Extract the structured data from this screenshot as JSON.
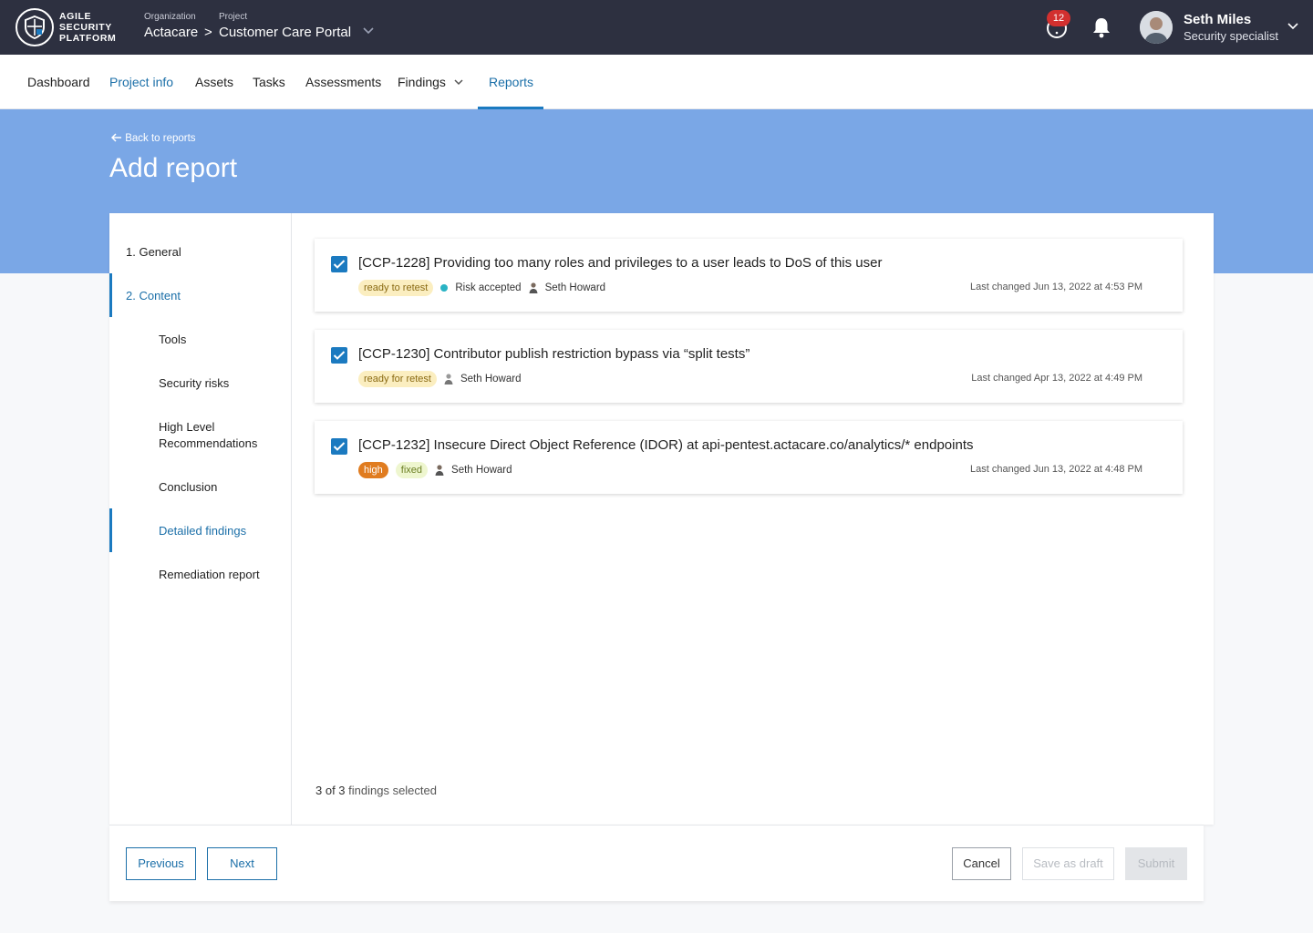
{
  "brand": {
    "logo_lines": [
      "AGILE",
      "SECURITY",
      "PLATFORM"
    ]
  },
  "breadcrumb": {
    "org_label": "Organization",
    "org_value": "Actacare",
    "project_label": "Project",
    "project_value": "Customer Care Portal",
    "separator": ">"
  },
  "header": {
    "notification_count": "12",
    "user_name": "Seth Miles",
    "user_role": "Security specialist"
  },
  "nav": {
    "items": [
      "Dashboard",
      "Project info",
      "Assets",
      "Tasks",
      "Assessments",
      "Findings",
      "Reports"
    ]
  },
  "page": {
    "back_label": "Back to reports",
    "title": "Add report"
  },
  "steps": {
    "general": "1. General",
    "content": "2. Content",
    "tools": "Tools",
    "security_risks": "Security risks",
    "high_level_line1": "High Level",
    "high_level_line2": "Recommendations",
    "conclusion": "Conclusion",
    "detailed_findings": "Detailed findings",
    "remediation": "Remediation report"
  },
  "findings": [
    {
      "title": "[CCP-1228] Providing too many roles and privileges to a user leads to DoS of this user",
      "tags": [
        "ready to retest"
      ],
      "status": "Risk accepted",
      "assignee": "Seth Howard",
      "changed": "Last changed Jun 13, 2022 at 4:53 PM",
      "checked": true
    },
    {
      "title": "[CCP-1230] Contributor publish restriction bypass via “split tests”",
      "tags": [
        "ready for retest"
      ],
      "status": "",
      "assignee": "Seth Howard",
      "changed": "Last changed Apr 13, 2022 at 4:49 PM",
      "checked": true
    },
    {
      "title": "[CCP-1232] Insecure Direct Object Reference (IDOR) at api-pentest.actacare.co/analytics/* endpoints",
      "tags": [
        "high",
        "fixed"
      ],
      "status": "",
      "assignee": "Seth Howard",
      "changed": "Last changed Jun 13, 2022 at 4:48 PM",
      "checked": true
    }
  ],
  "selection": {
    "count_strong": "3 of 3",
    "count_rest": " findings selected"
  },
  "footer": {
    "previous": "Previous",
    "next": "Next",
    "cancel": "Cancel",
    "save_draft": "Save as draft",
    "submit": "Submit"
  },
  "colors": {
    "topbar": "#2d3040",
    "band": "#7aa7e6",
    "accent": "#1b7ac0"
  }
}
